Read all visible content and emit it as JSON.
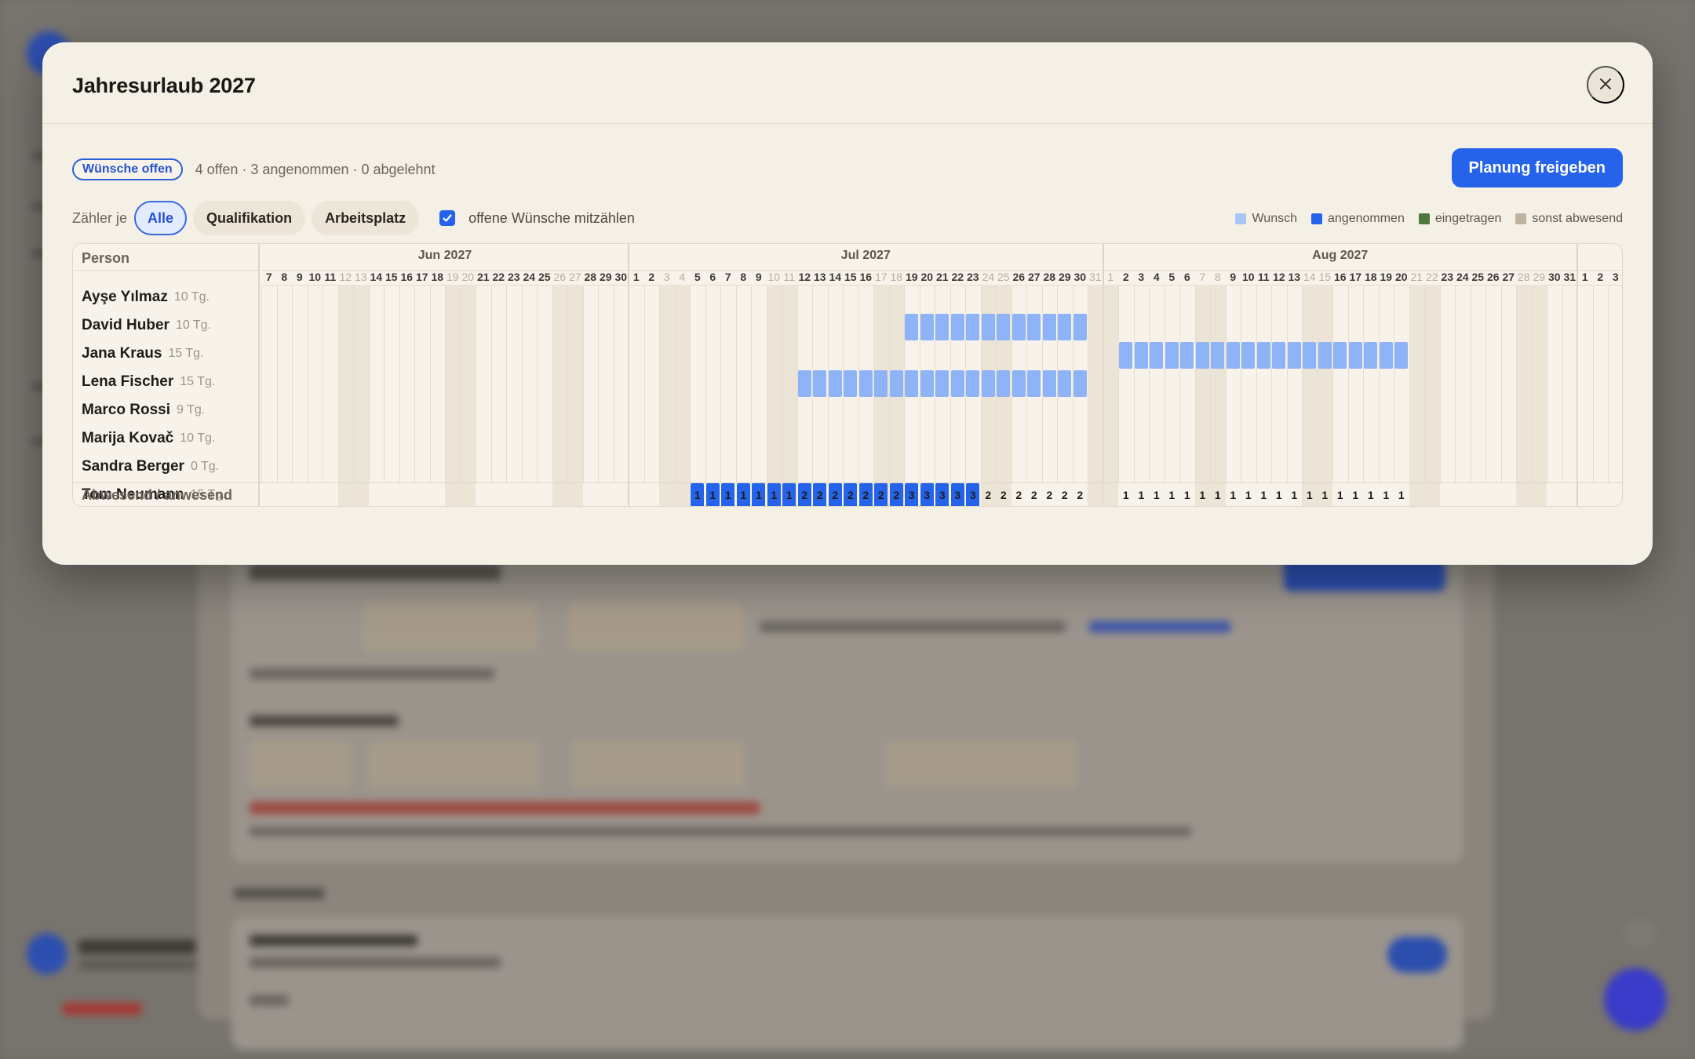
{
  "modal": {
    "title": "Jahresurlaub 2027",
    "status_badge": "Wünsche offen",
    "status_summary": "4 offen · 3 angenommen · 0 abgelehnt",
    "release_button": "Planung freigeben",
    "counter_label": "Zähler je",
    "filters": [
      "Alle",
      "Qualifikation",
      "Arbeitsplatz"
    ],
    "active_filter": "Alle",
    "count_open_checkbox": {
      "label": "offene Wünsche mitzählen",
      "checked": true
    }
  },
  "legend": [
    {
      "label": "Wunsch",
      "color": "#a9c4f7"
    },
    {
      "label": "angenommen",
      "color": "#2563eb"
    },
    {
      "label": "eingetragen",
      "color": "#4b7a3b"
    },
    {
      "label": "sonst abwesend",
      "color": "#bdb3a3"
    }
  ],
  "grid": {
    "person_header": "Person",
    "footer_label": "Abwesend / anwesend",
    "months": [
      {
        "label": "Jun 2027",
        "days": [
          7,
          8,
          9,
          10,
          11,
          12,
          13,
          14,
          15,
          16,
          17,
          18,
          19,
          20,
          21,
          22,
          23,
          24,
          25,
          26,
          27,
          28,
          29,
          30
        ],
        "weekend": [
          12,
          13,
          19,
          20,
          26,
          27
        ]
      },
      {
        "label": "Jul 2027",
        "days": [
          1,
          2,
          3,
          4,
          5,
          6,
          7,
          8,
          9,
          10,
          11,
          12,
          13,
          14,
          15,
          16,
          17,
          18,
          19,
          20,
          21,
          22,
          23,
          24,
          25,
          26,
          27,
          28,
          29,
          30,
          31
        ],
        "weekend": [
          3,
          4,
          10,
          11,
          17,
          18,
          24,
          25,
          31
        ]
      },
      {
        "label": "Aug 2027",
        "days": [
          1,
          2,
          3,
          4,
          5,
          6,
          7,
          8,
          9,
          10,
          11,
          12,
          13,
          14,
          15,
          16,
          17,
          18,
          19,
          20,
          21,
          22,
          23,
          24,
          25,
          26,
          27,
          28,
          29,
          30,
          31
        ],
        "weekend": [
          1,
          7,
          8,
          14,
          15,
          21,
          22,
          28,
          29
        ]
      },
      {
        "label": "",
        "days": [
          1,
          2,
          3
        ],
        "weekend": []
      }
    ],
    "persons": [
      {
        "name": "Ayşe Yılmaz",
        "days": "10 Tg."
      },
      {
        "name": "David Huber",
        "days": "10 Tg."
      },
      {
        "name": "Jana Kraus",
        "days": "15 Tg."
      },
      {
        "name": "Lena Fischer",
        "days": "15 Tg."
      },
      {
        "name": "Marco Rossi",
        "days": "9 Tg."
      },
      {
        "name": "Marija Kovač",
        "days": "10 Tg."
      },
      {
        "name": "Sandra Berger",
        "days": "0 Tg."
      },
      {
        "name": "Tom Neumann",
        "days": "15 Tg."
      }
    ],
    "bars": [
      {
        "person": 1,
        "status": "Wunsch",
        "from": "2027-07-19",
        "to": "2027-07-30"
      },
      {
        "person": 2,
        "status": "Wunsch",
        "from": "2027-08-02",
        "to": "2027-08-20"
      },
      {
        "person": 3,
        "status": "Wunsch",
        "from": "2027-07-12",
        "to": "2027-07-30"
      },
      {
        "person": 7,
        "status": "angenommen",
        "from": "2027-07-05",
        "to": "2027-07-23"
      }
    ],
    "absent_counts": {
      "2027-07-05": 1,
      "2027-07-06": 1,
      "2027-07-07": 1,
      "2027-07-08": 1,
      "2027-07-09": 1,
      "2027-07-10": 1,
      "2027-07-11": 1,
      "2027-07-12": 2,
      "2027-07-13": 2,
      "2027-07-14": 2,
      "2027-07-15": 2,
      "2027-07-16": 2,
      "2027-07-17": 2,
      "2027-07-18": 2,
      "2027-07-19": 3,
      "2027-07-20": 3,
      "2027-07-21": 3,
      "2027-07-22": 3,
      "2027-07-23": 3,
      "2027-07-24": 2,
      "2027-07-25": 2,
      "2027-07-26": 2,
      "2027-07-27": 2,
      "2027-07-28": 2,
      "2027-07-29": 2,
      "2027-07-30": 2,
      "2027-08-02": 1,
      "2027-08-03": 1,
      "2027-08-04": 1,
      "2027-08-05": 1,
      "2027-08-06": 1,
      "2027-08-07": 1,
      "2027-08-08": 1,
      "2027-08-09": 1,
      "2027-08-10": 1,
      "2027-08-11": 1,
      "2027-08-12": 1,
      "2027-08-13": 1,
      "2027-08-14": 1,
      "2027-08-15": 1,
      "2027-08-16": 1,
      "2027-08-17": 1,
      "2027-08-18": 1,
      "2027-08-19": 1,
      "2027-08-20": 1
    }
  }
}
